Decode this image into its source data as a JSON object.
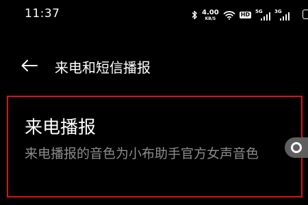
{
  "status_bar": {
    "time": "11:37",
    "net_speed_value": "4.00",
    "net_speed_unit": "KB/S",
    "hd_badge": "HD",
    "signal_1_label": "5G",
    "signal_2_label": "3G",
    "icons": [
      "bluetooth-icon",
      "wifi-icon",
      "signal-icon",
      "signal-icon",
      "battery-icon"
    ]
  },
  "header": {
    "back_icon": "back-arrow-icon",
    "title": "来电和短信播报"
  },
  "setting": {
    "title": "来电播报",
    "description": "来电播报的音色为小布助手官方女声音色",
    "toggle_state": "off"
  },
  "colors": {
    "background": "#000000",
    "text_primary": "#ffffff",
    "text_secondary": "#8c8c8c",
    "highlight_border": "#e0101a",
    "toggle_track": "#5e5e5e"
  }
}
